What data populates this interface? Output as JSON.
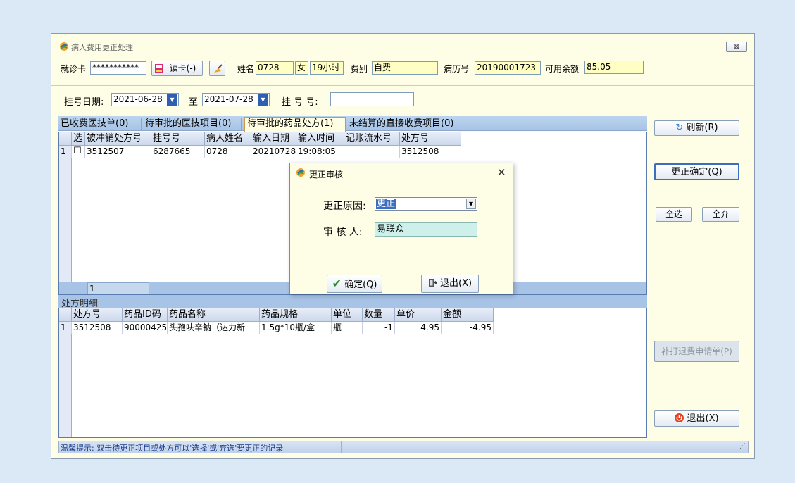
{
  "window": {
    "title": "病人费用更正处理",
    "close_label": "⊠"
  },
  "header": {
    "card_label": "就诊卡",
    "card_value": "***********",
    "read_card_label": "读卡(-)",
    "name_label": "姓名",
    "name_value": "0728",
    "sex_value": "女",
    "age_value": "19小时",
    "fee_type_label": "费别",
    "fee_type_value": "自费",
    "record_label": "病历号",
    "record_value": "20190001723",
    "balance_label": "可用余额",
    "balance_value": "85.05"
  },
  "filter": {
    "date_label": "挂号日期:",
    "date_from": "2021-06-28",
    "to_label": "至",
    "date_to": "2021-07-28",
    "reg_no_label": "挂 号 号:",
    "reg_no_value": ""
  },
  "tabs": [
    {
      "label": "已收费医技单(0)"
    },
    {
      "label": "待审批的医技项目(0)"
    },
    {
      "label": "待审批的药品处方(1)"
    },
    {
      "label": "未结算的直接收费项目(0)"
    }
  ],
  "upper_grid": {
    "columns": [
      "选",
      "被冲销处方号",
      "挂号号",
      "病人姓名",
      "输入日期",
      "输入时间",
      "记账流水号",
      "处方号"
    ],
    "rows": [
      {
        "num": "1",
        "check": "☐",
        "cells": [
          "3512507",
          "6287665",
          "0728",
          "20210728",
          "19:08:05",
          "",
          "3512508"
        ]
      }
    ],
    "footer_count": "1"
  },
  "detail": {
    "section_label": "处方明细",
    "columns": [
      "处方号",
      "药品ID码",
      "药品名称",
      "药品规格",
      "单位",
      "数量",
      "单价",
      "金额"
    ],
    "rows": [
      {
        "num": "1",
        "cells": [
          "3512508",
          "90000425:",
          "头孢呋辛钠（达力新",
          "1.5g*10瓶/盒",
          "瓶",
          "-1",
          "4.95",
          "-4.95"
        ]
      }
    ]
  },
  "right_panel": {
    "refresh": "刷新(R)",
    "confirm": "更正确定(Q)",
    "select_all": "全选",
    "deselect_all": "全弃",
    "reprint": "补打退费申请单(P)",
    "exit": "退出(X)"
  },
  "status_bar": {
    "hint": "温馨提示: 双击待更正项目或处方可以'选择'或'弃选'要更正的记录"
  },
  "dialog": {
    "title": "更正审核",
    "close": "✕",
    "reason_label": "更正原因:",
    "reason_value": "更正",
    "auditor_label": "审 核 人:",
    "auditor_value": "易联众",
    "ok": "确定(Q)",
    "exit": "退出(X)"
  },
  "colors": {
    "window_bg": "#fefde6",
    "tab_bar": "#a7c3e6",
    "field_yellow": "#ffffc4",
    "auditor_field": "#cdf0ea",
    "exit_icon": "#e8401c",
    "ok_check": "#2a8a2a"
  }
}
